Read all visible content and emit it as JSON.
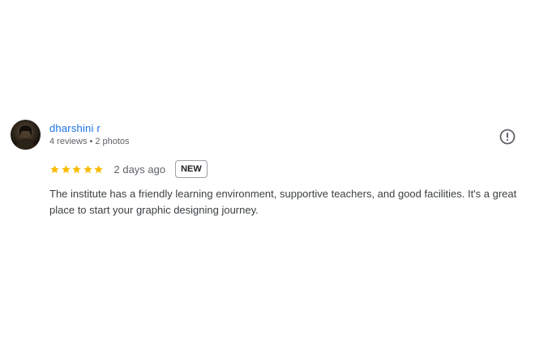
{
  "review": {
    "author": {
      "name": "dharshini r",
      "reviews": "4 reviews",
      "separator": "•",
      "photos": "2 photos",
      "avatar_icon": "user-avatar-photo"
    },
    "rating": {
      "stars": 5,
      "out_of": 5,
      "star_color": "#fbbc04"
    },
    "date": "2 days ago",
    "badge": "NEW",
    "report_icon": "exclamation-circle-icon",
    "text": "The institute has a friendly learning environment, supportive teachers, and good facilities. It's a great place to start your graphic designing journey."
  },
  "colors": {
    "author_name": "#1a73e8",
    "meta_text": "#5f6368",
    "body_text": "#3c4043"
  }
}
